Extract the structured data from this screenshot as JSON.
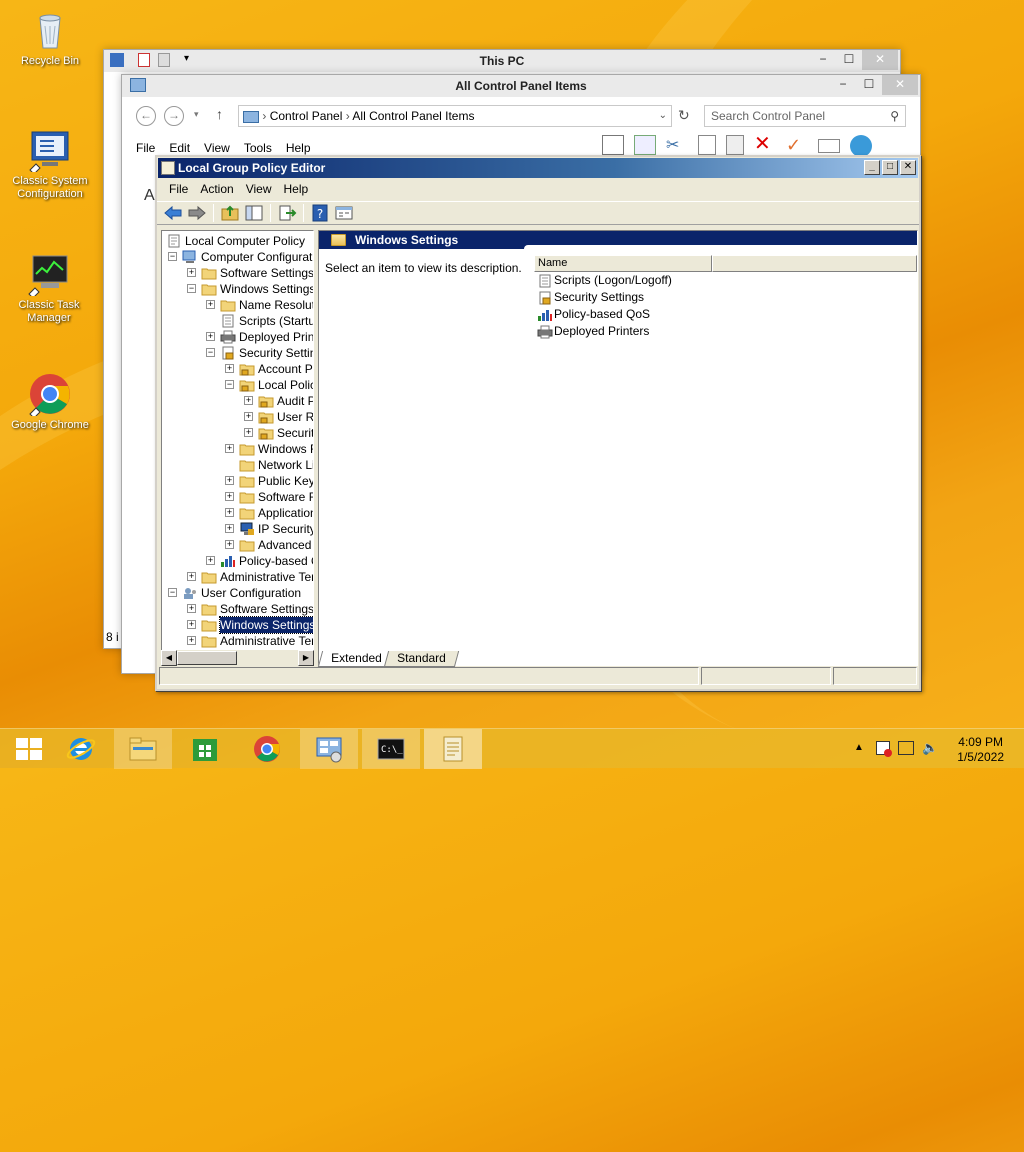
{
  "desktop": {
    "icons": [
      {
        "label": "Recycle Bin"
      },
      {
        "label": "Classic System Configuration"
      },
      {
        "label": "Classic Task Manager"
      },
      {
        "label": "Google Chrome"
      }
    ]
  },
  "this_pc": {
    "title": "This PC",
    "status_fragment": "8 i"
  },
  "control_panel": {
    "title": "All Control Panel Items",
    "breadcrumb": [
      "Control Panel",
      "All Control Panel Items"
    ],
    "search_placeholder": "Search Control Panel",
    "menu": [
      "File",
      "Edit",
      "View",
      "Tools",
      "Help"
    ],
    "fragment_letter": "A"
  },
  "gpo": {
    "title": "Local Group Policy Editor",
    "menu": [
      "File",
      "Action",
      "View",
      "Help"
    ],
    "tree": [
      {
        "label": "Local Computer Policy",
        "level": 0,
        "expander": "",
        "icon": "policy"
      },
      {
        "label": "Computer Configuratio",
        "level": 1,
        "expander": "−",
        "icon": "computer"
      },
      {
        "label": "Software Settings",
        "level": 2,
        "expander": "+",
        "icon": "folder"
      },
      {
        "label": "Windows Settings",
        "level": 2,
        "expander": "−",
        "icon": "folder"
      },
      {
        "label": "Name Resolutic",
        "level": 3,
        "expander": "+",
        "icon": "folder"
      },
      {
        "label": "Scripts (Startup",
        "level": 3,
        "expander": "",
        "icon": "script"
      },
      {
        "label": "Deployed Printe",
        "level": 3,
        "expander": "+",
        "icon": "printer"
      },
      {
        "label": "Security Setting",
        "level": 3,
        "expander": "−",
        "icon": "security"
      },
      {
        "label": "Account Po",
        "level": 4,
        "expander": "+",
        "icon": "lockfolder"
      },
      {
        "label": "Local Policie",
        "level": 4,
        "expander": "−",
        "icon": "lockfolder"
      },
      {
        "label": "Audit P",
        "level": 5,
        "expander": "+",
        "icon": "lockfolder"
      },
      {
        "label": "User Ri",
        "level": 5,
        "expander": "+",
        "icon": "lockfolder"
      },
      {
        "label": "Securit",
        "level": 5,
        "expander": "+",
        "icon": "lockfolder"
      },
      {
        "label": "Windows F",
        "level": 4,
        "expander": "+",
        "icon": "folder"
      },
      {
        "label": "Network Lis",
        "level": 4,
        "expander": "",
        "icon": "folder"
      },
      {
        "label": "Public Key I",
        "level": 4,
        "expander": "+",
        "icon": "folder"
      },
      {
        "label": "Software R",
        "level": 4,
        "expander": "+",
        "icon": "folder"
      },
      {
        "label": "Application",
        "level": 4,
        "expander": "+",
        "icon": "folder"
      },
      {
        "label": "IP Security",
        "level": 4,
        "expander": "+",
        "icon": "ipsec"
      },
      {
        "label": "Advanced .",
        "level": 4,
        "expander": "+",
        "icon": "folder"
      },
      {
        "label": "Policy-based Q",
        "level": 3,
        "expander": "+",
        "icon": "qos"
      },
      {
        "label": "Administrative Tem",
        "level": 2,
        "expander": "+",
        "icon": "folder"
      },
      {
        "label": "User Configuration",
        "level": 1,
        "expander": "−",
        "icon": "user"
      },
      {
        "label": "Software Settings",
        "level": 2,
        "expander": "+",
        "icon": "folder"
      },
      {
        "label": "Windows Settings",
        "level": 2,
        "expander": "+",
        "icon": "folder",
        "selected": true
      },
      {
        "label": "Administrative Tem",
        "level": 2,
        "expander": "+",
        "icon": "folder"
      }
    ],
    "right_header": "Windows Settings",
    "description": "Select an item to view its description.",
    "column_name": "Name",
    "items": [
      {
        "label": "Scripts (Logon/Logoff)",
        "icon": "script"
      },
      {
        "label": "Security Settings",
        "icon": "security"
      },
      {
        "label": "Policy-based QoS",
        "icon": "qos"
      },
      {
        "label": "Deployed Printers",
        "icon": "printer"
      }
    ],
    "tabs": [
      "Extended",
      "Standard"
    ],
    "active_tab": "Extended"
  },
  "taskbar": {
    "apps": [
      "start-icon",
      "ie-icon",
      "file-explorer-icon",
      "store-icon",
      "chrome-icon",
      "control-panel-icon",
      "cmd-icon",
      "gpo-icon"
    ],
    "time": "4:09 PM",
    "date": "1/5/2022"
  },
  "colors": {
    "accent": "#0a246a",
    "taskbar": "#e8b828",
    "desktop": "#f4a80b"
  }
}
